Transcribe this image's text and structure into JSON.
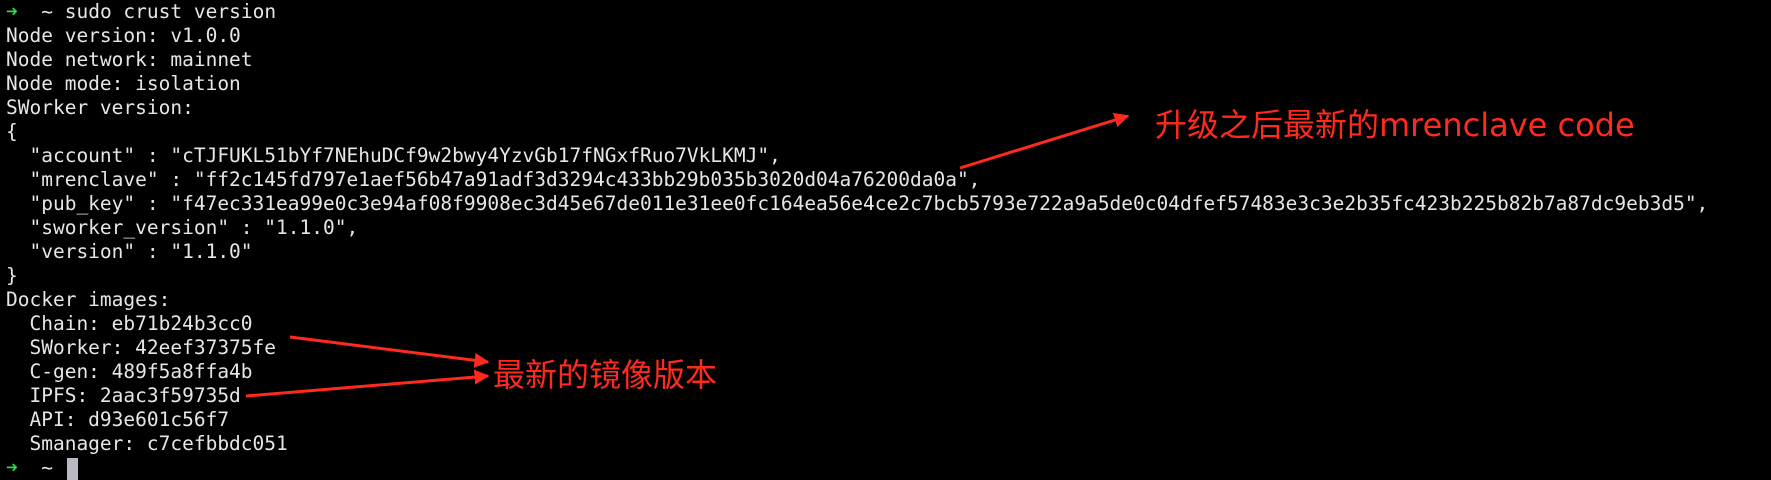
{
  "terminal": {
    "lines": [
      {
        "kind": "prompt",
        "arrow": "➜",
        "tilde": "~",
        "text": "sudo crust version"
      },
      {
        "kind": "out",
        "text": "Node version: v1.0.0"
      },
      {
        "kind": "out",
        "text": "Node network: mainnet"
      },
      {
        "kind": "out",
        "text": "Node mode: isolation"
      },
      {
        "kind": "out",
        "text": "SWorker version:"
      },
      {
        "kind": "out",
        "text": "{"
      },
      {
        "kind": "out",
        "text": "  \"account\" : \"cTJFUKL51bYf7NEhuDCf9w2bwy4YzvGb17fNGxfRuo7VkLKMJ\","
      },
      {
        "kind": "out",
        "text": "  \"mrenclave\" : \"ff2c145fd797e1aef56b47a91adf3d3294c433bb29b035b3020d04a76200da0a\","
      },
      {
        "kind": "out",
        "text": "  \"pub_key\" : \"f47ec331ea99e0c3e94af08f9908ec3d45e67de011e31ee0fc164ea56e4ce2c7bcb5793e722a9a5de0c04dfef57483e3c3e2b35fc423b225b82b7a87dc9eb3d5\","
      },
      {
        "kind": "out",
        "text": "  \"sworker_version\" : \"1.1.0\","
      },
      {
        "kind": "out",
        "text": "  \"version\" : \"1.1.0\""
      },
      {
        "kind": "out",
        "text": "}"
      },
      {
        "kind": "out",
        "text": "Docker images:"
      },
      {
        "kind": "out",
        "text": "  Chain: eb71b24b3cc0"
      },
      {
        "kind": "out",
        "text": "  SWorker: 42eef37375fe"
      },
      {
        "kind": "out",
        "text": "  C-gen: 489f5a8ffa4b"
      },
      {
        "kind": "out",
        "text": "  IPFS: 2aac3f59735d"
      },
      {
        "kind": "out",
        "text": "  API: d93e601c56f7"
      },
      {
        "kind": "out",
        "text": "  Smanager: c7cefbbdc051"
      },
      {
        "kind": "prompt",
        "arrow": "➜",
        "tilde": "~",
        "text": ""
      }
    ]
  },
  "annotations": {
    "mrenclave_note": "升级之后最新的mrenclave code",
    "images_note": "最新的镜像版本"
  },
  "colors": {
    "background": "#000000",
    "text": "#e6e6e6",
    "prompt_arrow": "#2bd94b",
    "annotation": "#ff2a1e",
    "cursor": "#b9b9c3"
  }
}
